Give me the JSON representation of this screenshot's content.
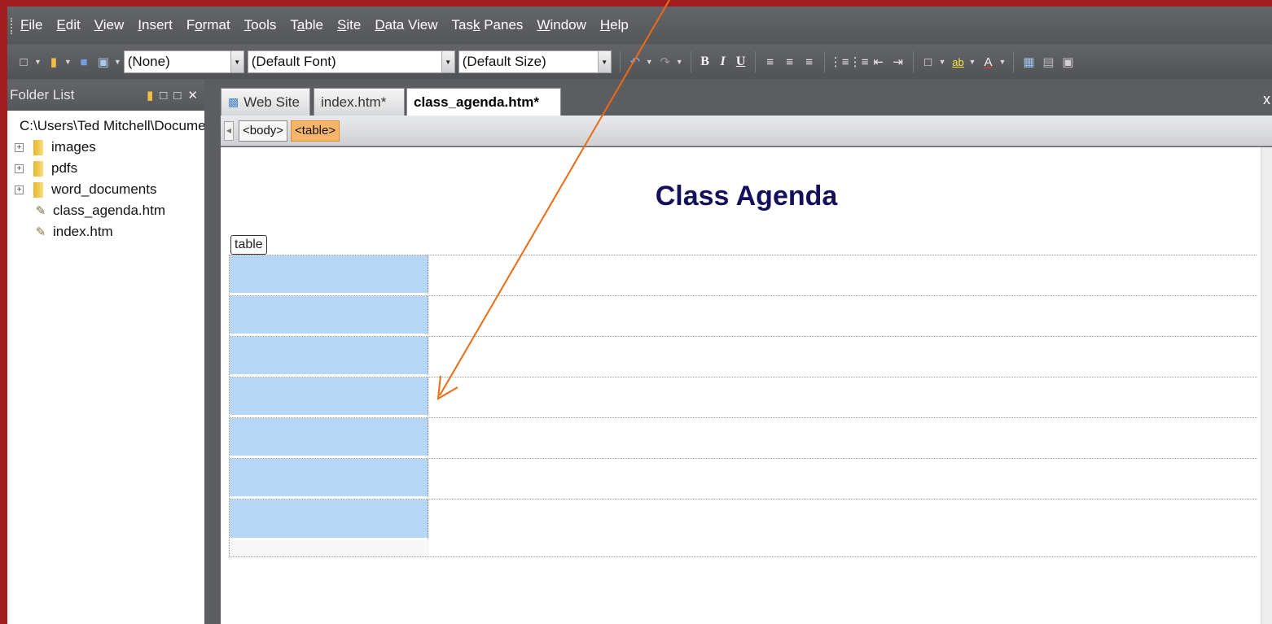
{
  "menu": {
    "items": [
      {
        "pre": "",
        "u": "F",
        "post": "ile"
      },
      {
        "pre": "",
        "u": "E",
        "post": "dit"
      },
      {
        "pre": "",
        "u": "V",
        "post": "iew"
      },
      {
        "pre": "",
        "u": "I",
        "post": "nsert"
      },
      {
        "pre": "F",
        "u": "o",
        "post": "rmat"
      },
      {
        "pre": "",
        "u": "T",
        "post": "ools"
      },
      {
        "pre": "T",
        "u": "a",
        "post": "ble"
      },
      {
        "pre": "",
        "u": "S",
        "post": "ite"
      },
      {
        "pre": "",
        "u": "D",
        "post": "ata View"
      },
      {
        "pre": "Tas",
        "u": "k",
        "post": " Panes"
      },
      {
        "pre": "",
        "u": "W",
        "post": "indow"
      },
      {
        "pre": "",
        "u": "H",
        "post": "elp"
      }
    ]
  },
  "toolbar": {
    "style_value": "(None)",
    "font_value": "(Default Font)",
    "size_value": "(Default Size)",
    "bold": "B",
    "italic": "I",
    "underline": "U",
    "highlight": "ab",
    "fontcolor": "A"
  },
  "folder_list": {
    "title": "Folder List",
    "root": "C:\\Users\\Ted Mitchell\\Documents",
    "items": [
      {
        "label": "images",
        "type": "folder"
      },
      {
        "label": "pdfs",
        "type": "folder"
      },
      {
        "label": "word_documents",
        "type": "folder"
      },
      {
        "label": "class_agenda.htm",
        "type": "file"
      },
      {
        "label": "index.htm",
        "type": "file"
      }
    ]
  },
  "tabs": [
    {
      "label": "Web Site",
      "active": false
    },
    {
      "label": "index.htm*",
      "active": false
    },
    {
      "label": "class_agenda.htm*",
      "active": true
    }
  ],
  "tab_close": "x",
  "quick_tags": [
    {
      "label": "<body>",
      "selected": false
    },
    {
      "label": "<table>",
      "selected": true
    }
  ],
  "page": {
    "title": "Class Agenda",
    "table_label": "table",
    "table_rows": 7
  },
  "colors": {
    "frame": "#a01d22",
    "selected_cell": "#b7d6f5",
    "title": "#14105c",
    "arrow": "#ee6a13"
  }
}
